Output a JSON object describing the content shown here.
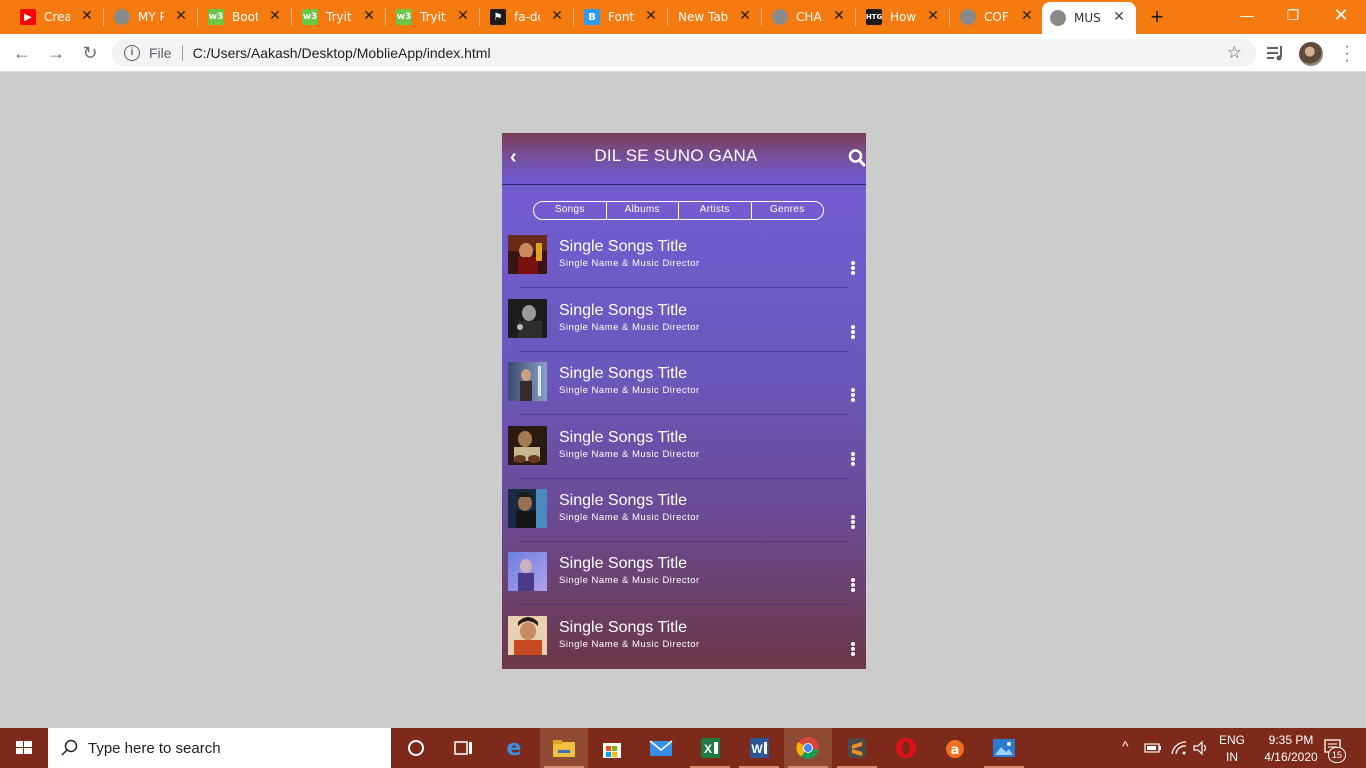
{
  "browser": {
    "tabs": [
      {
        "title": "Creat",
        "favicon": "youtube-icon",
        "color": "#ff0000"
      },
      {
        "title": "MY P",
        "favicon": "globe-icon",
        "color": "#8a8a8a"
      },
      {
        "title": "Boot",
        "favicon": "w3schools-icon",
        "color": "#6cc644"
      },
      {
        "title": "Tryit",
        "favicon": "w3schools-icon",
        "color": "#6cc644"
      },
      {
        "title": "Tryit",
        "favicon": "w3schools-icon",
        "color": "#6cc644"
      },
      {
        "title": "fa-dc",
        "favicon": "flag-icon",
        "color": "#1b1b1b"
      },
      {
        "title": "Font",
        "favicon": "bootstrap-icon",
        "color": "#2b9af3"
      },
      {
        "title": "New Tab",
        "favicon": "",
        "color": ""
      },
      {
        "title": "CHA",
        "favicon": "globe-icon",
        "color": "#8a8a8a"
      },
      {
        "title": "How",
        "favicon": "htg-icon",
        "color": "#1b1b1b"
      },
      {
        "title": "COF",
        "favicon": "globe-icon",
        "color": "#8a8a8a"
      },
      {
        "title": "MUS",
        "favicon": "globe-icon",
        "color": "#8a8a8a",
        "active": true
      }
    ],
    "address": {
      "scheme_label": "File",
      "url": "C:/Users/Aakash/Desktop/MoblieApp/index.html"
    }
  },
  "app": {
    "title": "DIL SE SUNO GANA",
    "tabs": [
      "Songs",
      "Albums",
      "Artists",
      "Genres"
    ],
    "songs": [
      {
        "title": "Single Songs Title",
        "subtitle": "Single Name & Music Director"
      },
      {
        "title": "Single Songs Title",
        "subtitle": "Single Name & Music Director"
      },
      {
        "title": "Single Songs Title",
        "subtitle": "Single Name & Music Director"
      },
      {
        "title": "Single Songs Title",
        "subtitle": "Single Name & Music Director"
      },
      {
        "title": "Single Songs Title",
        "subtitle": "Single Name & Music Director"
      },
      {
        "title": "Single Songs Title",
        "subtitle": "Single Name & Music Director"
      },
      {
        "title": "Single Songs Title",
        "subtitle": "Single Name & Music Director"
      }
    ]
  },
  "taskbar": {
    "search_placeholder": "Type here to search",
    "language": "ENG",
    "region": "IN",
    "time": "9:35 PM",
    "date": "4/16/2020",
    "notification_count": "15"
  },
  "colors": {
    "chrome_accent": "#f57a0f",
    "taskbar": "#7d2a1a",
    "app_gradient_top": "#7a5bd6",
    "app_gradient_bottom": "#6b3746"
  }
}
